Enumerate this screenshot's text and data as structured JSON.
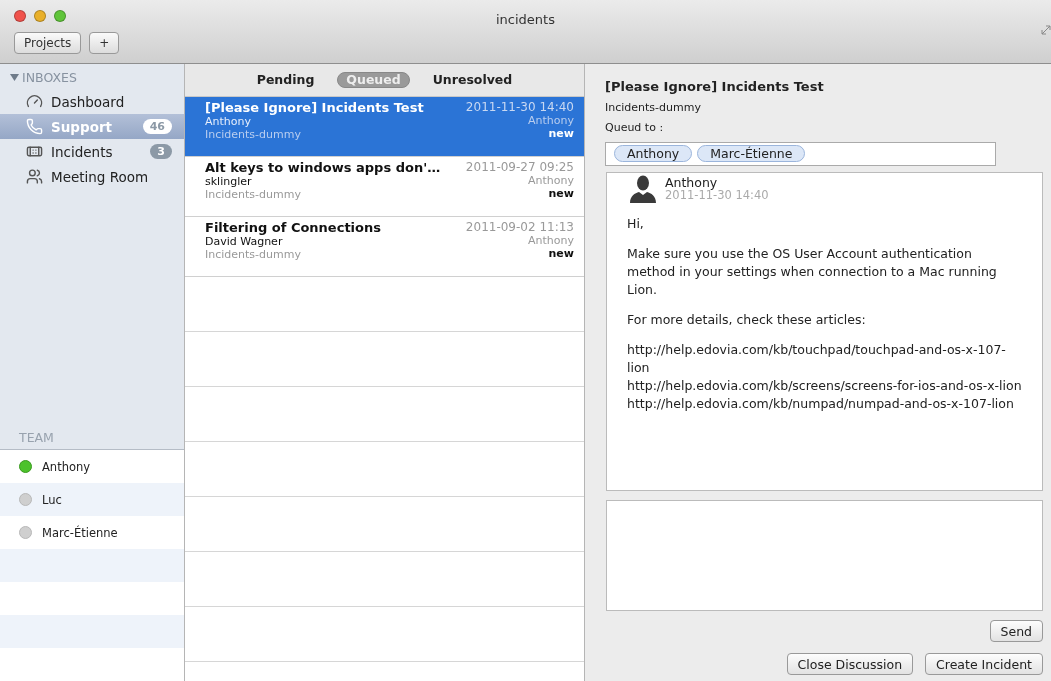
{
  "window": {
    "title": "incidents"
  },
  "toolbar": {
    "buttons": [
      "Projects",
      "+"
    ]
  },
  "sidebar": {
    "inboxes": {
      "label": "INBOXES",
      "expanded": true,
      "items": [
        {
          "label": "Dashboard",
          "kind": "dashboard",
          "selected": false
        },
        {
          "label": "Support",
          "kind": "phone",
          "selected": true,
          "badge": "46"
        },
        {
          "label": "Incidents",
          "kind": "bandage",
          "selected": false,
          "badge": "3"
        },
        {
          "label": "Meeting Room",
          "kind": "people",
          "selected": false
        }
      ]
    },
    "team": {
      "label": "TEAM",
      "members": [
        {
          "name": "Anthony",
          "online": true
        },
        {
          "name": "Luc",
          "online": false
        },
        {
          "name": "Marc-Étienne",
          "online": false
        }
      ]
    }
  },
  "tabs": [
    {
      "label": "Pending",
      "selected": false
    },
    {
      "label": "Queued",
      "selected": true
    },
    {
      "label": "Unresolved",
      "selected": false
    }
  ],
  "incidents": [
    {
      "title": "[Please Ignore] Incidents Test",
      "from": "Anthony",
      "project": "Incidents-dummy",
      "date": "2011-11-30 14:40",
      "assignee": "Anthony",
      "status": "new",
      "selected": true
    },
    {
      "title": "Alt keys to windows apps don'…",
      "from": "sklingler",
      "project": "Incidents-dummy",
      "date": "2011-09-27 09:25",
      "assignee": "Anthony",
      "status": "new",
      "selected": false
    },
    {
      "title": "Filtering of Connections",
      "from": "David Wagner",
      "project": "Incidents-dummy",
      "date": "2011-09-02 11:13",
      "assignee": "Anthony",
      "status": "new",
      "selected": false
    }
  ],
  "detail": {
    "title": "[Please Ignore] Incidents Test",
    "project": "Incidents-dummy",
    "queued_label": "Queud to :",
    "queued_to": [
      "Anthony",
      "Marc-Étienne"
    ],
    "message": {
      "author": "Anthony",
      "date": "2011-11-30 14:40",
      "paragraphs": [
        "Hi,",
        "Make sure you use the OS User Account authentication method in your settings when connection to a Mac running Lion.",
        "For more details, check these articles:"
      ],
      "links": [
        "http://help.edovia.com/kb/touchpad/touchpad-and-os-x-107-lion",
        "http://help.edovia.com/kb/screens/screens-for-ios-and-os-x-lion",
        "http://help.edovia.com/kb/numpad/numpad-and-os-x-107-lion"
      ]
    },
    "send_button": "Send",
    "buttons": [
      "Close Discussion",
      "Create Incident"
    ]
  }
}
